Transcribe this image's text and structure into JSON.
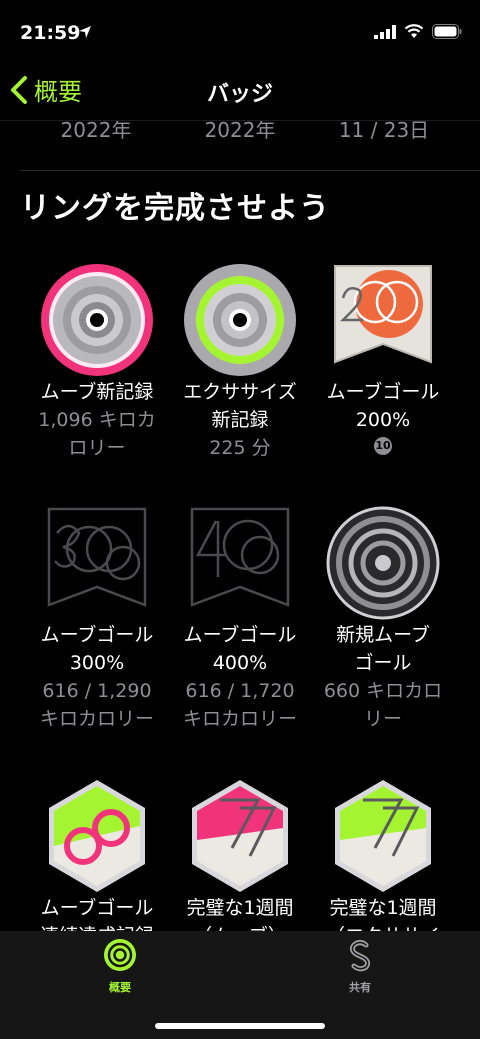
{
  "status": {
    "time": "21:59"
  },
  "nav": {
    "back_label": "概要",
    "title": "バッジ"
  },
  "previous_row": [
    "2022年",
    "2022年",
    "11 / 23日"
  ],
  "section": {
    "title": "リングを完成させよう"
  },
  "badges": [
    {
      "name1": "ムーブ新記録",
      "sub1": "1,096 キロカ",
      "sub2": "ロリー"
    },
    {
      "name1": "エクササイズ",
      "name2": "新記録",
      "sub1": "225 分"
    },
    {
      "name1": "ムーブゴール",
      "name2": "200%",
      "count": "10"
    },
    {
      "name1": "ムーブゴール",
      "name2": "300%",
      "sub1": "616 / 1,290",
      "sub2": "キロカロリー"
    },
    {
      "name1": "ムーブゴール",
      "name2": "400%",
      "sub1": "616 / 1,720",
      "sub2": "キロカロリー"
    },
    {
      "name1": "新規ムーブ",
      "name2": "ゴール",
      "sub1": "660 キロカロ",
      "sub2": "リー"
    },
    {
      "name1": "ムーブゴール",
      "name2": "連続達成記録"
    },
    {
      "name1": "完璧な1週間",
      "name2": "（ムーブ）"
    },
    {
      "name1": "完璧な1週間",
      "name2": "（エクササイ"
    }
  ],
  "tabs": [
    {
      "label": "概要",
      "active": true
    },
    {
      "label": "共有",
      "active": false
    }
  ],
  "colors": {
    "accent": "#a5f432",
    "move": "#f0337a",
    "exercise": "#a5f432",
    "orange": "#ee6a3e"
  }
}
